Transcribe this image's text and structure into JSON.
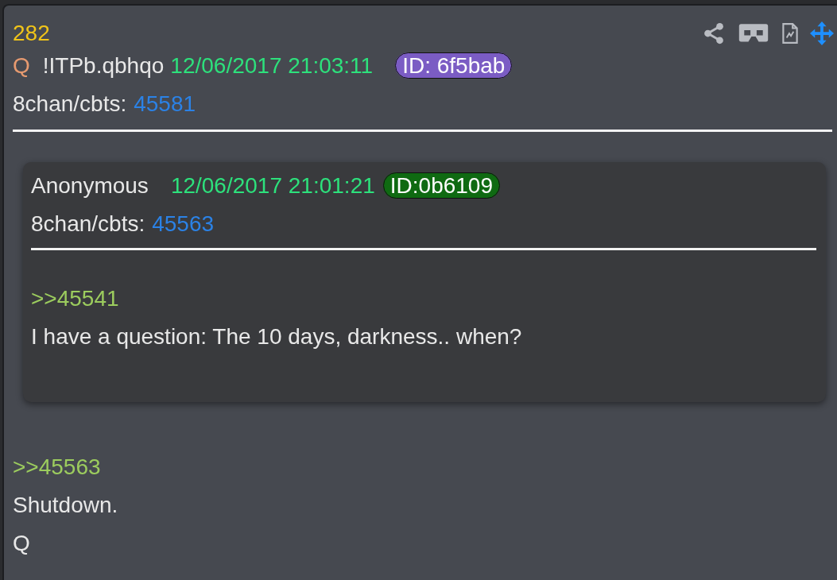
{
  "post": {
    "number": "282",
    "author": "Q",
    "tripcode": "!ITPb.qbhqo",
    "timestamp": "12/06/2017 21:03:11",
    "id_badge": {
      "label": "ID: 6f5bab",
      "color": "#7b5cc4"
    },
    "board": "8chan/cbts:",
    "post_number": "45581",
    "quoted_post": {
      "author": "Anonymous",
      "timestamp": "12/06/2017 21:01:21",
      "id_badge": {
        "label": "ID:0b6109",
        "color": "#0f6a12"
      },
      "board": "8chan/cbts:",
      "post_number": "45563",
      "body": [
        {
          "kind": "quote",
          "text": ">>45541"
        },
        {
          "kind": "text",
          "text": "I have a question: The 10 days, darkness.. when?"
        }
      ]
    },
    "body": [
      {
        "kind": "quote",
        "text": ">>45563"
      },
      {
        "kind": "text",
        "text": "Shutdown."
      },
      {
        "kind": "text",
        "text": "Q"
      }
    ]
  }
}
